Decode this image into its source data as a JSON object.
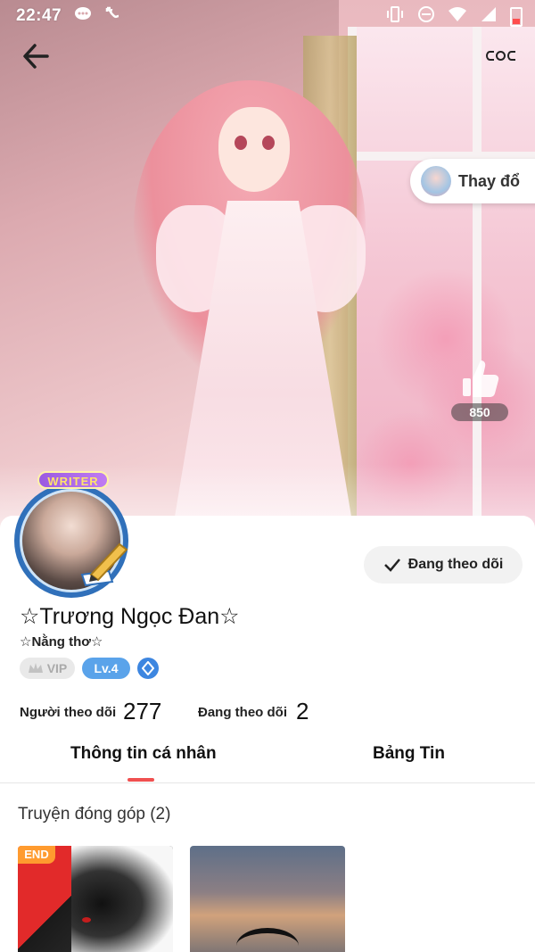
{
  "status_bar": {
    "time": "22:47"
  },
  "header": {
    "back_icon": "arrow-left-icon",
    "more_icon": "more-icon",
    "change_cover_label": "Thay đổ",
    "like_count": "850"
  },
  "profile": {
    "writer_badge": "WRITER",
    "name": "☆Trương Ngọc Đan☆",
    "bio": "☆Nằng thơ☆",
    "follow_state_label": "Đang theo dõi",
    "vip_label": "VIP",
    "level_label": "Lv.4"
  },
  "stats": {
    "followers_label": "Người theo dõi",
    "followers_value": "277",
    "following_label": "Đang theo dõi",
    "following_value": "2"
  },
  "tabs": [
    {
      "label": "Thông tin cá nhân",
      "active": true
    },
    {
      "label": "Bảng Tin",
      "active": false
    }
  ],
  "contributions": {
    "title": "Truyện đóng góp (2)",
    "items": [
      {
        "badge": "END"
      },
      {
        "badge": ""
      }
    ]
  },
  "colors": {
    "accent_red": "#f05050",
    "level_blue": "#5aa3ea",
    "end_orange": "#ff9b2f"
  }
}
